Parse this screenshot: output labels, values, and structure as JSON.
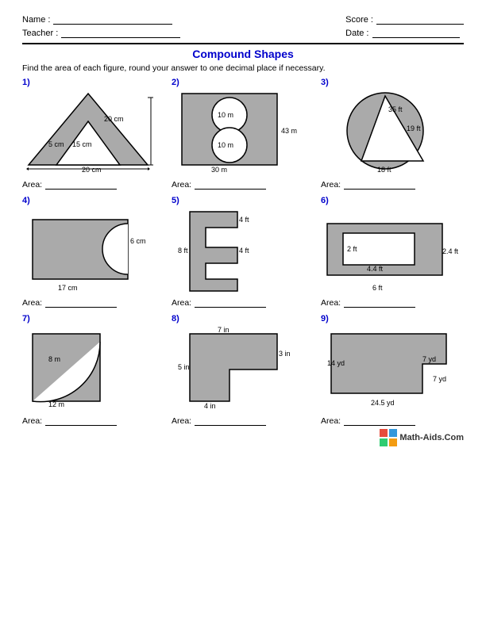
{
  "header": {
    "name_label": "Name :",
    "teacher_label": "Teacher :",
    "score_label": "Score :",
    "date_label": "Date :"
  },
  "title": "Compound Shapes",
  "instructions": "Find the area of each figure, round your answer to one decimal place if necessary.",
  "problems": [
    {
      "number": "1)"
    },
    {
      "number": "2)"
    },
    {
      "number": "3)"
    },
    {
      "number": "4)"
    },
    {
      "number": "5)"
    },
    {
      "number": "6)"
    },
    {
      "number": "7)"
    },
    {
      "number": "8)"
    },
    {
      "number": "9)"
    }
  ],
  "area_label": "Area:",
  "footer": "Math-Aids.Com"
}
